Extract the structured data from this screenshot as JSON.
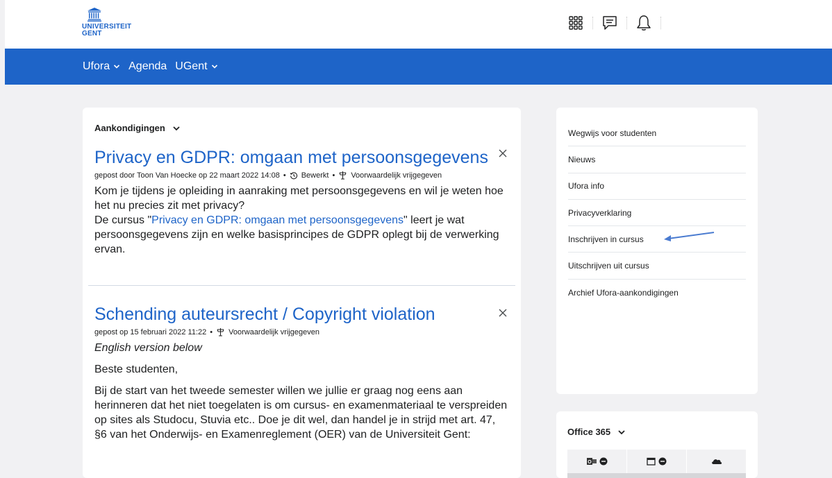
{
  "header": {
    "logo_line1": "UNIVERSITEIT",
    "logo_line2": "GENT",
    "icons": [
      "grid-icon",
      "chat-icon",
      "bell-icon"
    ]
  },
  "nav": {
    "items": [
      {
        "label": "Ufora",
        "dropdown": true
      },
      {
        "label": "Agenda",
        "dropdown": false
      },
      {
        "label": "UGent",
        "dropdown": true
      }
    ]
  },
  "announcements": {
    "title": "Aankondigingen",
    "items": [
      {
        "title": "Privacy en GDPR: omgaan met persoonsgegevens",
        "meta_posted": "gepost door Toon Van Hoecke op 22 maart 2022 14:08",
        "meta_edited": "Bewerkt",
        "meta_release": "Voorwaardelijk vrijgegeven",
        "body_line1": "Kom je tijdens je opleiding in aanraking met persoonsgegevens en wil je weten hoe het nu precies zit met privacy?",
        "body_prefix": "De cursus \"",
        "body_link": "Privacy en GDPR: omgaan met persoonsgegevens",
        "body_suffix": "\" leert je wat persoonsgegevens zijn en welke basisprincipes de GDPR oplegt bij de verwerking ervan."
      },
      {
        "title": "Schending auteursrecht / Copyright violation",
        "meta_posted": "gepost op 15 februari 2022 11:22",
        "meta_release": "Voorwaardelijk vrijgegeven",
        "body_italic": "English version below",
        "body_greeting": "Beste studenten,",
        "body_para": "Bij de start van het tweede semester willen we jullie er graag nog eens aan herinneren dat het niet toegelaten is om cursus- en examenmateriaal te verspreiden op sites als Studocu, Stuvia etc.. Doe je dit wel, dan handel je in strijd met art. 47, §6 van het Onderwijs- en Examenreglement (OER) van de Universiteit Gent:"
      }
    ]
  },
  "links": {
    "items": [
      "Wegwijs voor studenten",
      "Nieuws",
      "Ufora info",
      "Privacyverklaring",
      "Inschrijven in cursus",
      "Uitschrijven uit cursus",
      "Archief Ufora-aankondigingen"
    ]
  },
  "office": {
    "title": "Office 365",
    "tabs": [
      "outlook-mail-icon",
      "calendar-icon",
      "onedrive-icon"
    ]
  },
  "colors": {
    "brand": "#1e64c8",
    "background": "#f1f1f3"
  }
}
